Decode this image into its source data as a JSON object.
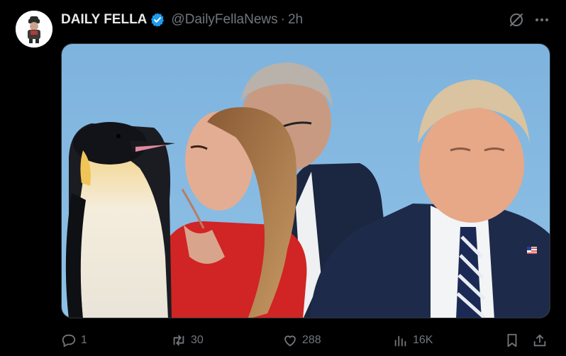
{
  "author": {
    "display_name": "DAILY FELLA",
    "handle": "@DailyFellaNews",
    "separator": "·",
    "timestamp": "2h",
    "verified_color": "#1d9bf0"
  },
  "media": {
    "type": "photo",
    "subjects": [
      "penguin",
      "woman in red dress",
      "man in background",
      "man in suit and striped tie"
    ]
  },
  "actions": {
    "reply_count": "1",
    "repost_count": "30",
    "like_count": "288",
    "views_count": "16K"
  },
  "icons": [
    "grok-icon",
    "more-icon",
    "reply-icon",
    "repost-icon",
    "like-icon",
    "views-icon",
    "bookmark-icon",
    "share-icon"
  ],
  "colors": {
    "background": "#000000",
    "text": "#e7e9ea",
    "muted": "#71767b",
    "accent": "#1d9bf0"
  }
}
